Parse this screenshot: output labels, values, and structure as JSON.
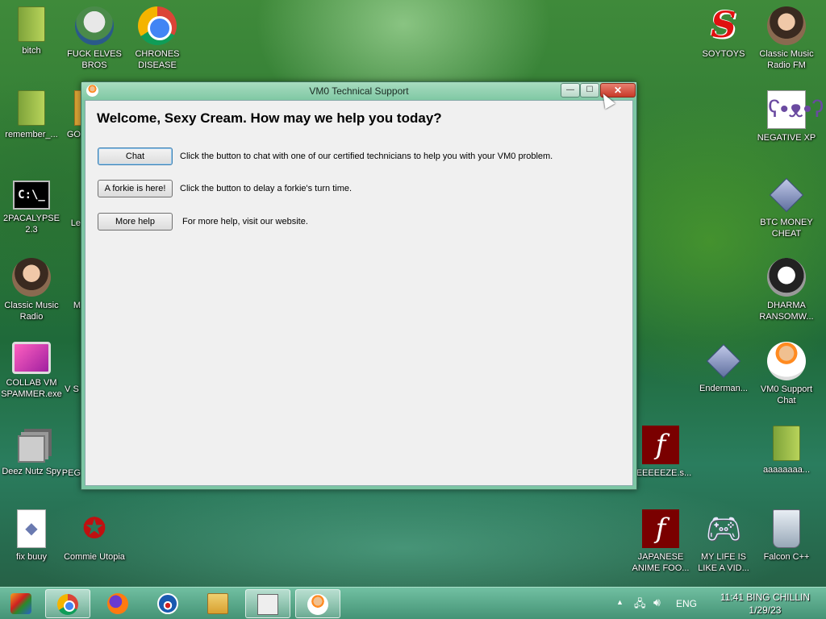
{
  "desktop_icons": {
    "bitch": "bitch",
    "fuck_elves_bros": "FUCK ELVES BROS",
    "chrones_disease": "CHRONES DISEASE",
    "soytoys": "SOYTOYS",
    "classic_music_fm": "Classic Music Radio FM",
    "remember": "remember_...",
    "go_partial": "GO",
    "negative_xp": "NEGATIVE XP",
    "twopacalypse": "2PACALYPSE 2.3",
    "le_partial": "Le",
    "btc_money_cheat": "BTC MONEY CHEAT",
    "classic_music_radio": "Classic Music Radio",
    "m_partial": "M",
    "dharma": "DHARMA RANSOMW...",
    "collab_vm": "COLLAB VM SPAMMER.exe",
    "v_partial": "V S",
    "enderman": "Enderman...",
    "vm0_support_chat": "VM0 Support Chat",
    "deez_nutz": "Deez Nutz Spy",
    "peg_partial": "PEG",
    "reeeeeze": "REEEEEZE.s...",
    "aaaaaaaa": "aaaaaaaa...",
    "fix_buuy": "fix buuy",
    "commie_utopia": "Commie Utopia",
    "japanese_anime": "JAPANESE ANIME FOO...",
    "my_life": "MY LIFE IS LIKE A VID...",
    "falcon": "Falcon C++"
  },
  "window": {
    "title": "VM0 Technical Support",
    "welcome": "Welcome, Sexy Cream. How may we help you today?",
    "rows": [
      {
        "button": "Chat",
        "description": "Click the button to chat with one of our certified technicians to help you with your VM0 problem."
      },
      {
        "button": "A forkie is here!",
        "description": "Click the button to delay a forkie's turn time."
      },
      {
        "button": "More help",
        "description": "For more help, visit our website."
      }
    ],
    "close_glyph": "✕",
    "min_glyph": "—",
    "max_glyph": "☐"
  },
  "taskbar": {
    "tray_arrow": "▲",
    "language": "ENG",
    "time": "11:41 BING CHILLIN",
    "date": "1/29/23"
  }
}
